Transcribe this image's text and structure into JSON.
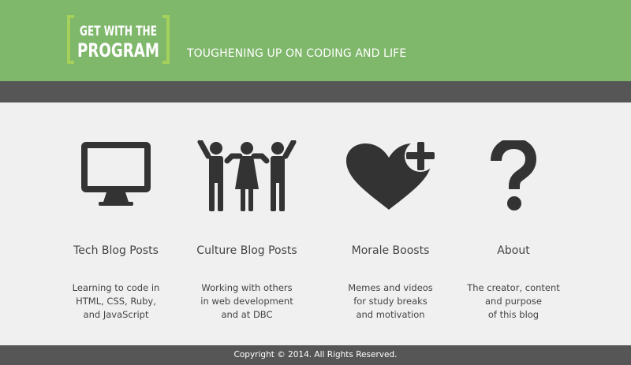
{
  "header": {
    "logo_line1": "GET WITH THE",
    "logo_line2": "PROGRAM",
    "tagline": "TOUGHENING UP ON CODING AND LIFE"
  },
  "cards": [
    {
      "title": "Tech Blog Posts",
      "icon": "monitor-icon",
      "desc": [
        "Learning to code in",
        "HTML, CSS, Ruby,",
        "and JavaScript"
      ]
    },
    {
      "title": "Culture Blog Posts",
      "icon": "people-icon",
      "desc": [
        "Working with others",
        "in web development",
        "and at DBC"
      ]
    },
    {
      "title": "Morale Boosts",
      "icon": "heart-plus-icon",
      "desc": [
        "Memes and videos",
        "for study breaks",
        "and motivation"
      ]
    },
    {
      "title": "About",
      "icon": "question-mark-icon",
      "desc": [
        "The creator, content",
        "and purpose",
        "of this blog"
      ]
    }
  ],
  "footer": {
    "copyright": "Copyright © 2014. All Rights Reserved."
  },
  "colors": {
    "header_green": "#7fb76b",
    "logo_accent": "#a5d05a",
    "dark_bar": "#565656",
    "icon_dark": "#333333",
    "background": "#f0f0f0"
  }
}
